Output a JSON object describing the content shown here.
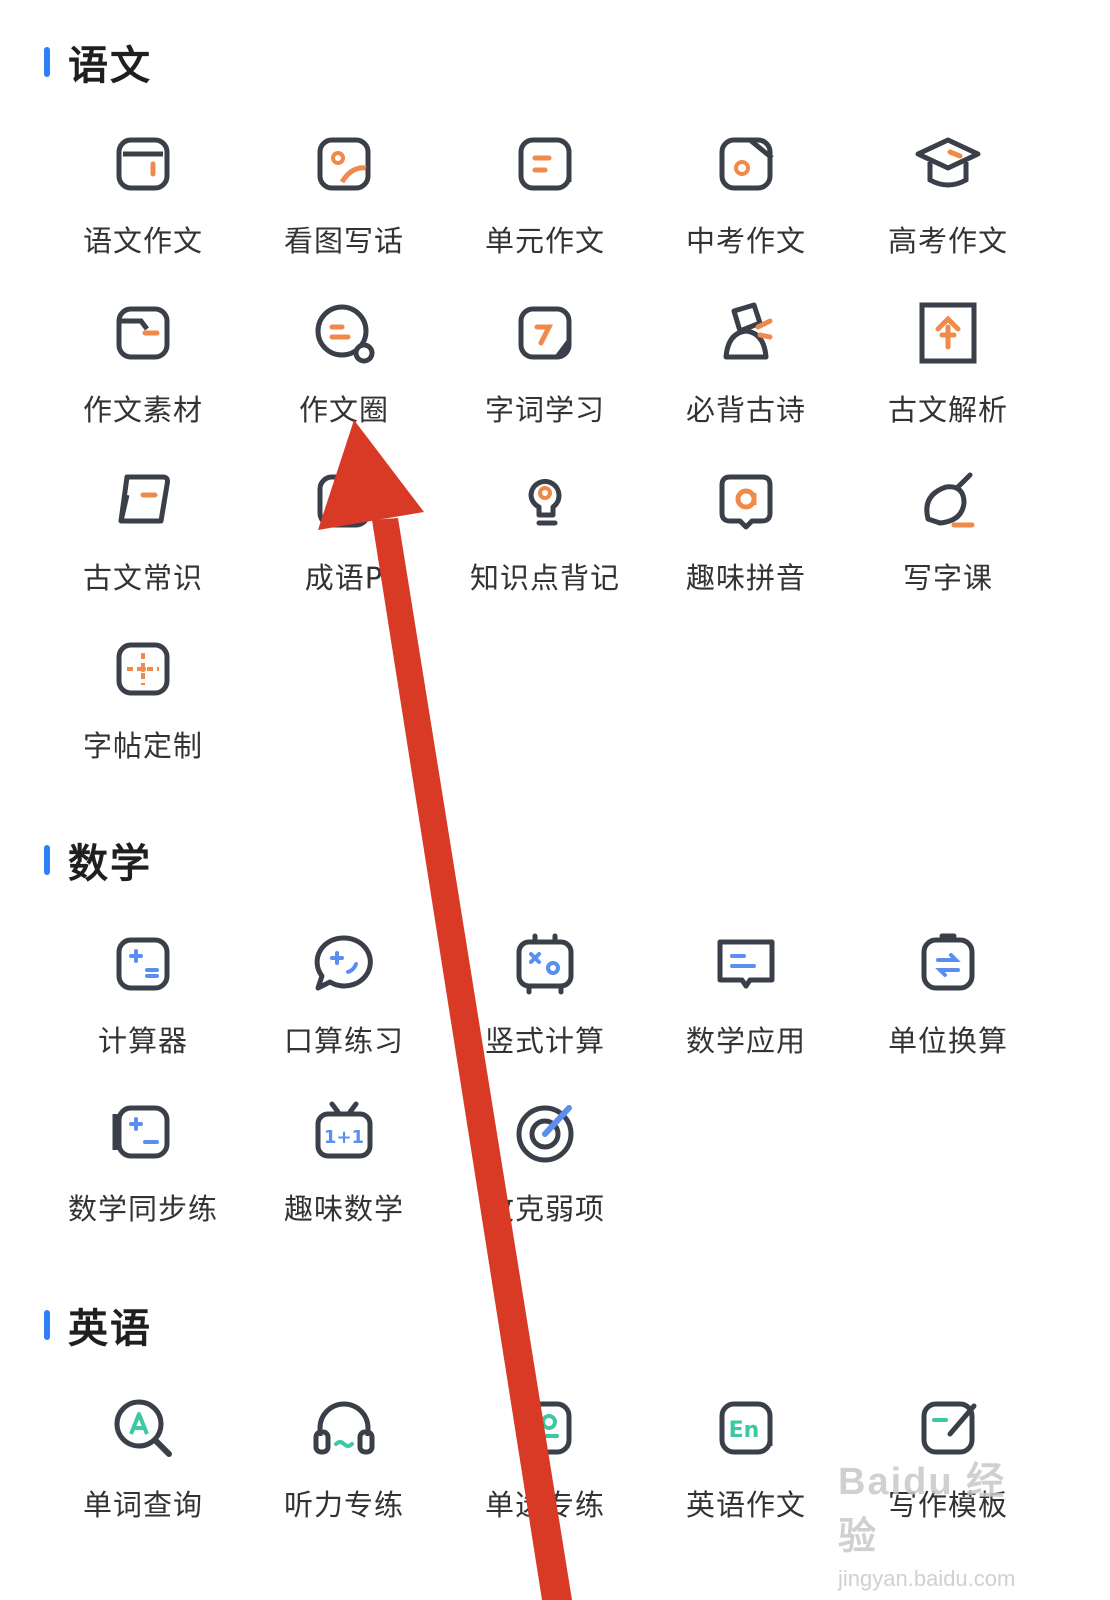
{
  "colors": {
    "accent": "#2f7ff7",
    "stroke": "#3a3f4a",
    "orange": "#f08a4b",
    "blue": "#5a8ff0",
    "green": "#3cc9a2",
    "arrow": "#d93a26"
  },
  "sections": [
    {
      "title": "语文",
      "items": [
        {
          "label": "语文作文",
          "icon": "notebook-icon",
          "hl": "orange"
        },
        {
          "label": "看图写话",
          "icon": "picture-icon",
          "hl": "orange"
        },
        {
          "label": "单元作文",
          "icon": "book-stack-icon",
          "hl": "orange"
        },
        {
          "label": "中考作文",
          "icon": "pencil-box-icon",
          "hl": "orange"
        },
        {
          "label": "高考作文",
          "icon": "graduation-cap-icon",
          "hl": "orange"
        },
        {
          "label": "作文素材",
          "icon": "folder-icon",
          "hl": "orange"
        },
        {
          "label": "作文圈",
          "icon": "chat-circle-icon",
          "hl": "orange"
        },
        {
          "label": "字词学习",
          "icon": "char-pencil-icon",
          "hl": "orange"
        },
        {
          "label": "必背古诗",
          "icon": "poet-icon",
          "hl": "orange"
        },
        {
          "label": "古文解析",
          "icon": "scroll-frame-icon",
          "hl": "orange"
        },
        {
          "label": "古文常识",
          "icon": "ancient-book-icon",
          "hl": "orange"
        },
        {
          "label": "成语P",
          "icon": "idiom-book-icon",
          "hl": "orange"
        },
        {
          "label": "知识点背记",
          "icon": "lightbulb-icon",
          "hl": "orange"
        },
        {
          "label": "趣味拼音",
          "icon": "pinyin-bubble-icon",
          "hl": "orange"
        },
        {
          "label": "写字课",
          "icon": "brush-icon",
          "hl": "orange"
        },
        {
          "label": "字帖定制",
          "icon": "grid-paper-icon",
          "hl": "orange"
        }
      ]
    },
    {
      "title": "数学",
      "items": [
        {
          "label": "计算器",
          "icon": "calculator-icon",
          "hl": "blue"
        },
        {
          "label": "口算练习",
          "icon": "oral-math-bubble-icon",
          "hl": "blue"
        },
        {
          "label": "竖式计算",
          "icon": "vertical-calc-icon",
          "hl": "blue"
        },
        {
          "label": "数学应用",
          "icon": "math-apply-icon",
          "hl": "blue"
        },
        {
          "label": "单位换算",
          "icon": "unit-convert-icon",
          "hl": "blue"
        },
        {
          "label": "数学同步练",
          "icon": "math-sync-icon",
          "hl": "blue"
        },
        {
          "label": "趣味数学",
          "icon": "fun-math-tv-icon",
          "hl": "blue"
        },
        {
          "label": "攻克弱项",
          "icon": "target-icon",
          "hl": "blue"
        }
      ]
    },
    {
      "title": "英语",
      "items": [
        {
          "label": "单词查询",
          "icon": "word-search-icon",
          "hl": "green"
        },
        {
          "label": "听力专练",
          "icon": "headphones-icon",
          "hl": "green"
        },
        {
          "label": "单选专练",
          "icon": "single-choice-icon",
          "hl": "green"
        },
        {
          "label": "英语作文",
          "icon": "english-essay-icon",
          "hl": "green"
        },
        {
          "label": "写作模板",
          "icon": "writing-template-icon",
          "hl": "green"
        }
      ]
    }
  ],
  "watermark": {
    "brand": "Baidu 经验",
    "url": "jingyan.baidu.com"
  }
}
